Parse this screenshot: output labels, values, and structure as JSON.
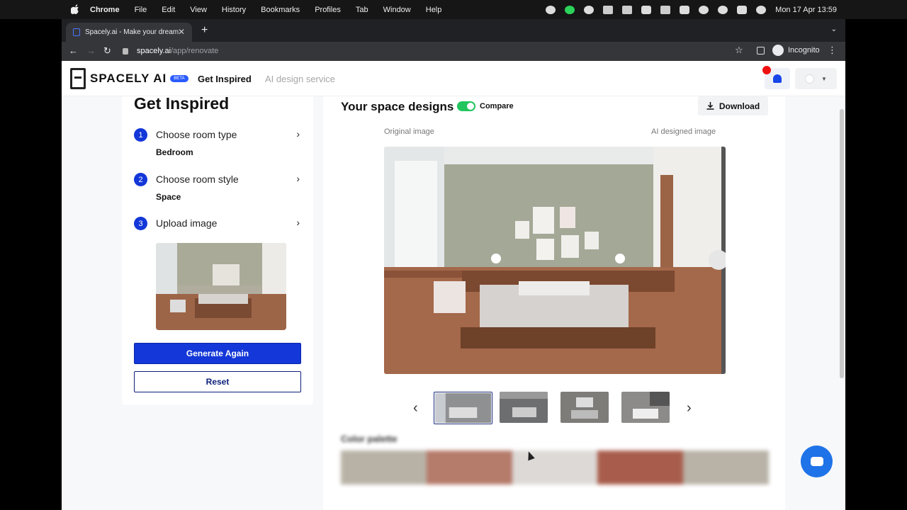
{
  "menubar": {
    "items": [
      "Chrome",
      "File",
      "Edit",
      "View",
      "History",
      "Bookmarks",
      "Profiles",
      "Tab",
      "Window",
      "Help"
    ],
    "datetime": "Mon 17 Apr  13:59"
  },
  "browser": {
    "tab_title": "Spacely.ai - Make your dream",
    "url_host": "spacely.ai",
    "url_path": "/app/renovate",
    "profile": "Incognito"
  },
  "header": {
    "logo_text": "SPACELY AI",
    "beta": "BETA",
    "nav": [
      "Get Inspired",
      "AI design service"
    ]
  },
  "left": {
    "title": "Get Inspired",
    "steps": [
      {
        "num": "1",
        "label": "Choose room type",
        "value": "Bedroom"
      },
      {
        "num": "2",
        "label": "Choose room style",
        "value": "Space"
      },
      {
        "num": "3",
        "label": "Upload image",
        "value": ""
      }
    ],
    "generate": "Generate Again",
    "reset": "Reset"
  },
  "right": {
    "title": "Your space designs",
    "compare": "Compare",
    "download": "Download",
    "original": "Original image",
    "ai": "AI designed image",
    "palette_title": "Color palette"
  },
  "colors": {
    "primary": "#1337d8",
    "toggle": "#22c55e",
    "chat": "#1e73e8",
    "palette": [
      "#b8b2a6",
      "#b57b6b",
      "#dcd9d6",
      "#a85d4c",
      "#b9b2a7"
    ]
  }
}
